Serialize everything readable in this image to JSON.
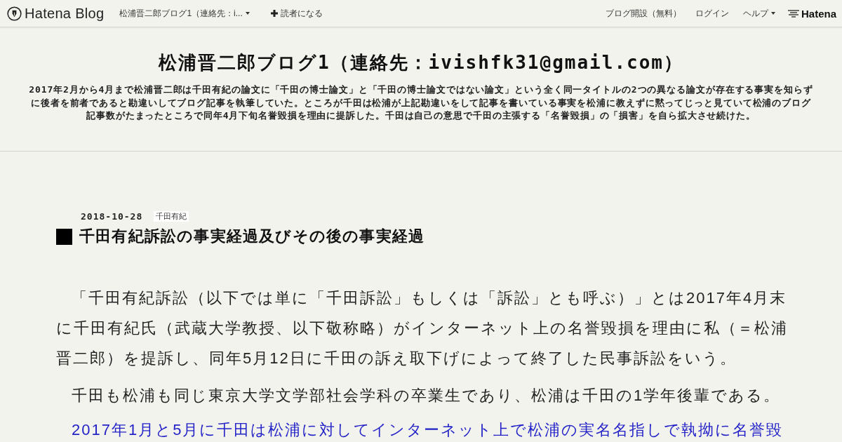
{
  "navbar": {
    "logo": {
      "text": "Hatena Blog"
    },
    "blog_menu": {
      "label": "松浦晋二郎ブログ1（連絡先：i..."
    },
    "subscribe_button": {
      "label": "読者になる"
    },
    "right_links": [
      {
        "label": "ブログ開設（無料）",
        "kind": "link"
      },
      {
        "label": "ログイン",
        "kind": "link"
      },
      {
        "label": "ヘルプ",
        "kind": "menu"
      }
    ],
    "brand": {
      "text": "Hatena"
    }
  },
  "header": {
    "title": "松浦晋二郎ブログ1（連絡先：ivishfk31@gmail.com）",
    "description": "2017年2月から4月まで松浦晋二郎は千田有紀の論文に「千田の博士論文」と「千田の博士論文ではない論文」という全く同一タイトルの2つの異なる論文が存在する事実を知らずに後者を前者であると勘違いしてブログ記事を執筆していた。ところが千田は松浦が上記勘違いをして記事を書いている事実を松浦に教えずに黙ってじっと見ていて松浦のブログ記事数がたまったところで同年4月下旬名誉毀損を理由に提訴した。千田は自己の意思で千田の主張する「名誉毀損」の「損害」を自ら拡大させ続けた。"
  },
  "entry": {
    "date": "2018-10-28",
    "category": "千田有紀",
    "title": "千田有紀訴訟の事実経過及びその後の事実経過",
    "paragraphs": [
      {
        "text": "「千田有紀訴訟（以下では単に「千田訴訟」もしくは「訴訟」とも呼ぶ）」とは2017年4月末に千田有紀氏（武蔵大学教授、以下敬称略）がインターネット上の名誉毀損を理由に私（＝松浦晋二郎）を提訴し、同年5月12日に千田の訴え取下げによって終了した民事訴訟をいう。",
        "color": "#222222"
      },
      {
        "text": "千田も松浦も同じ東京大学文学部社会学科の卒業生であり、松浦は千田の1学年後輩である。",
        "color": "#222222"
      },
      {
        "text": "2017年1月と5月に千田は松浦に対してインターネット上で松浦の実名名指しで執拗に名誉毀",
        "color": "#2323c8"
      }
    ]
  }
}
